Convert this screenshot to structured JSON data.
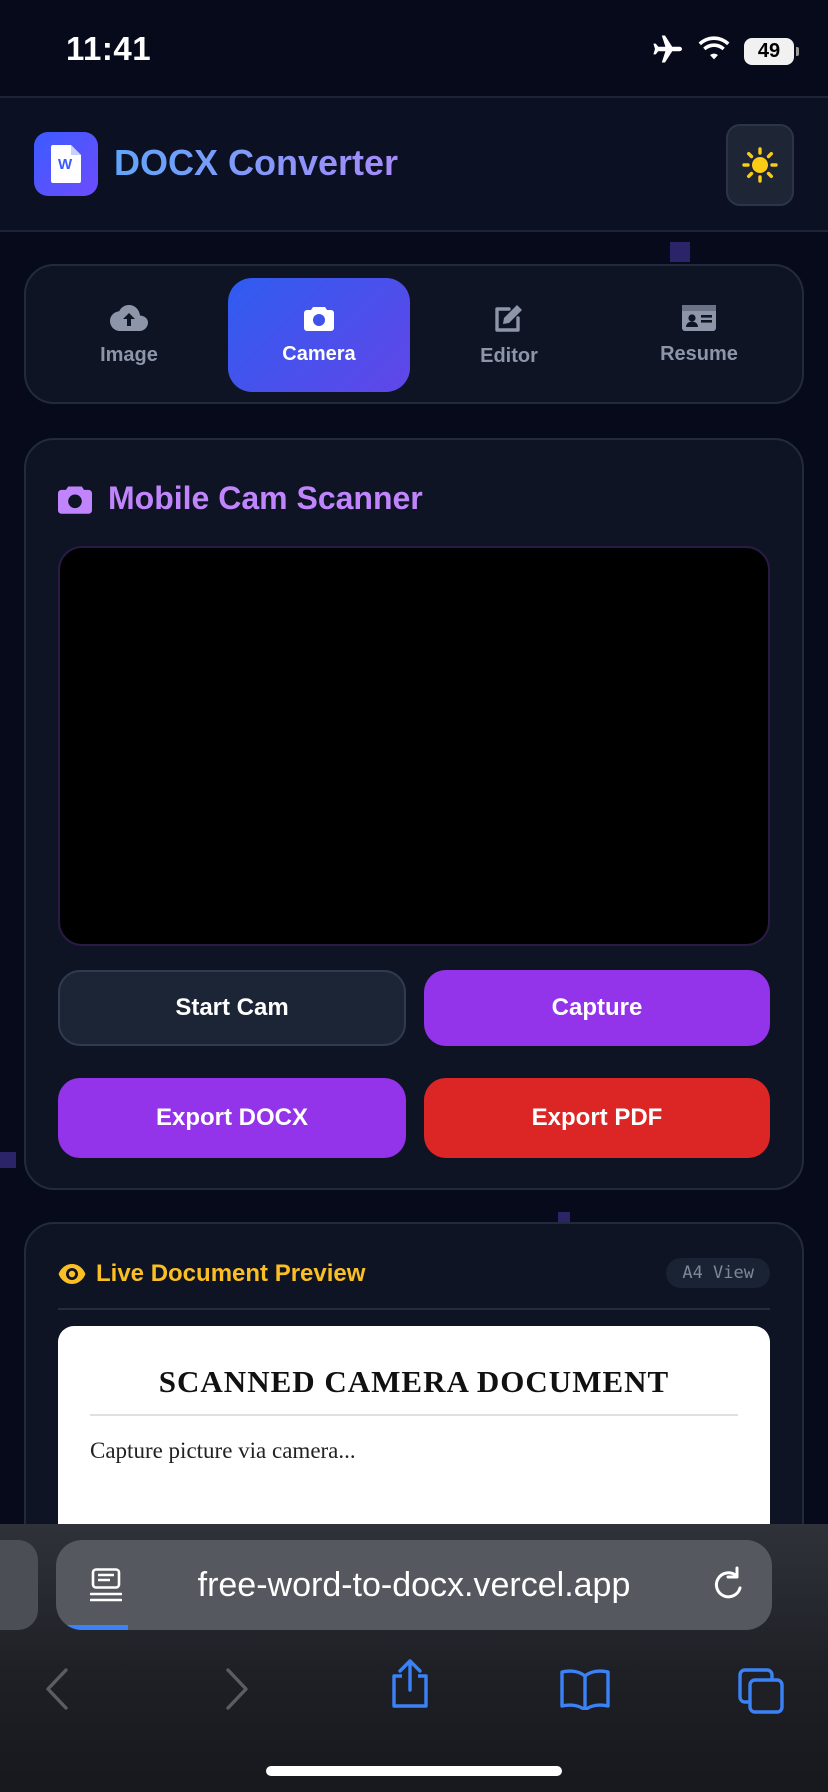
{
  "status_bar": {
    "time": "11:41",
    "battery": "49",
    "icons": [
      "airplane-icon",
      "wifi-icon",
      "battery-icon"
    ]
  },
  "header": {
    "logo_letter": "W",
    "title": "DOCX Converter",
    "theme_toggle_icon": "sun-icon"
  },
  "tabs": [
    {
      "label": "Image",
      "icon": "cloud-upload-icon",
      "active": false
    },
    {
      "label": "Camera",
      "icon": "camera-icon",
      "active": true
    },
    {
      "label": "Editor",
      "icon": "edit-icon",
      "active": false
    },
    {
      "label": "Resume",
      "icon": "id-card-icon",
      "active": false
    }
  ],
  "scanner": {
    "title": "Mobile Cam Scanner",
    "start_label": "Start Cam",
    "capture_label": "Capture",
    "export_docx_label": "Export DOCX",
    "export_pdf_label": "Export PDF"
  },
  "preview": {
    "title": "Live Document Preview",
    "badge": "A4 View",
    "doc_heading": "SCANNED CAMERA DOCUMENT",
    "doc_body": "Capture picture via camera..."
  },
  "browser": {
    "url": "free-word-to-docx.vercel.app",
    "nav_icons": [
      "back-icon",
      "forward-icon",
      "share-icon",
      "bookmarks-icon",
      "tabs-icon"
    ]
  },
  "colors": {
    "background": "#060a1a",
    "accent_purple": "#9333ea",
    "accent_red": "#dc2626",
    "tab_active_start": "#2f5cf0",
    "tab_active_end": "#6146e8",
    "scanner_title": "#c084fc",
    "preview_title": "#fbbf24"
  }
}
